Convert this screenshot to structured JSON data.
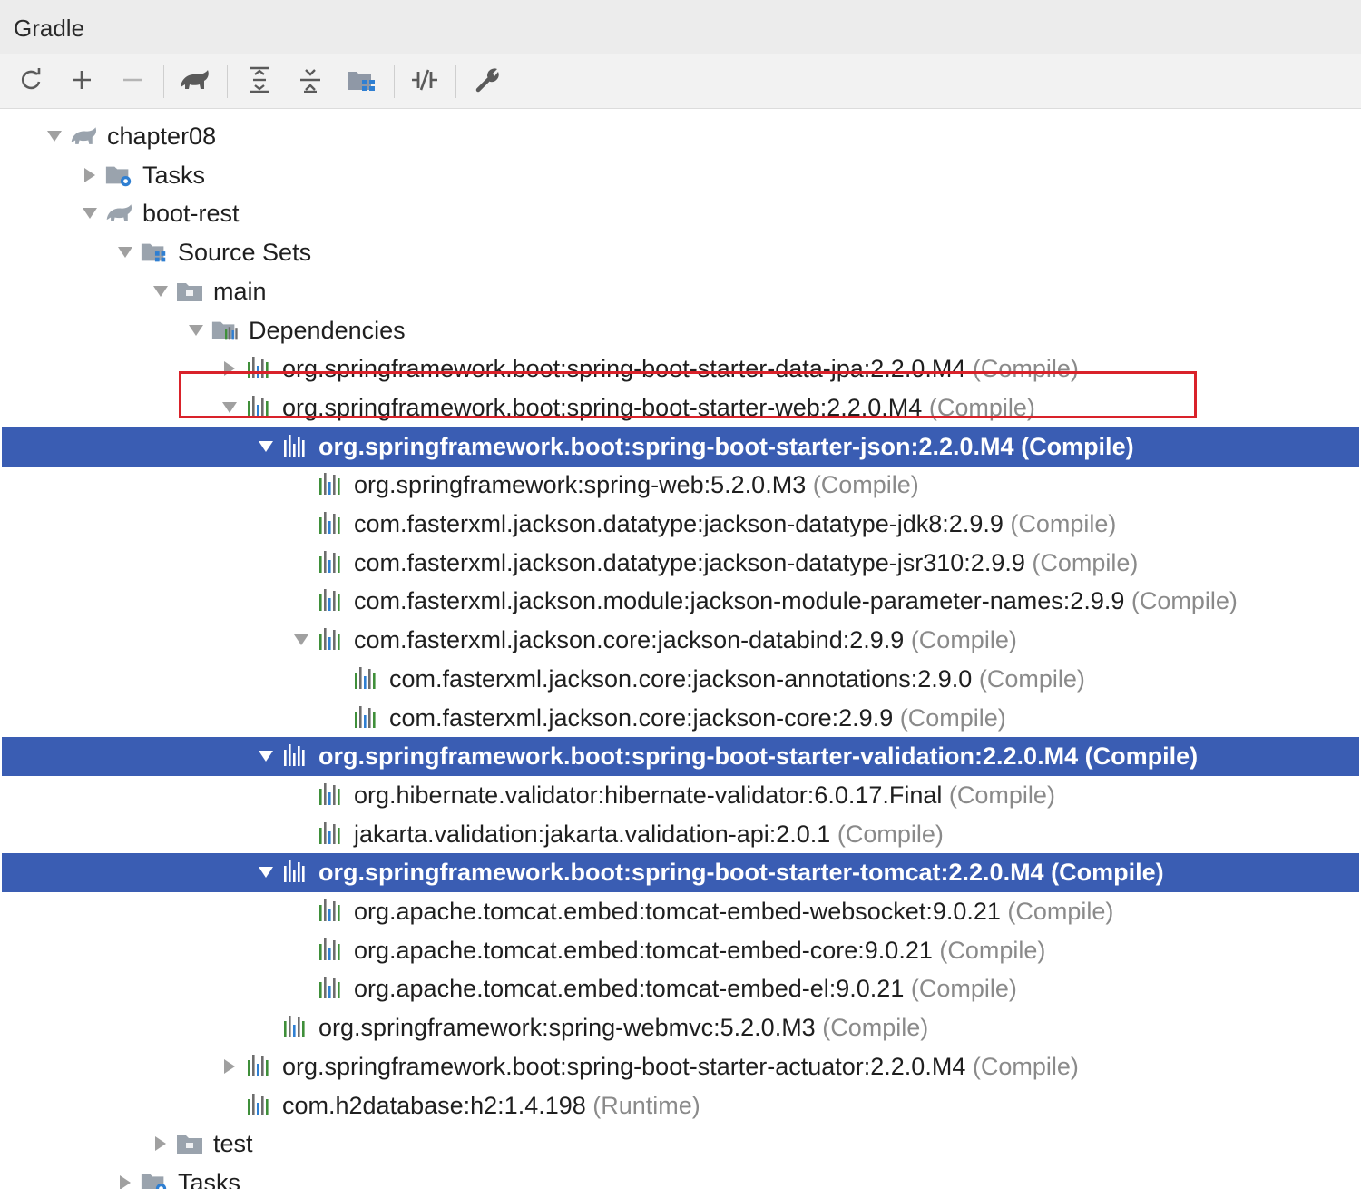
{
  "window": {
    "title": "Gradle"
  },
  "toolbar": {
    "buttons": [
      {
        "name": "refresh-icon"
      },
      {
        "name": "add-icon"
      },
      {
        "name": "remove-icon"
      },
      {
        "name": "gradle-elephant-icon"
      },
      {
        "name": "expand-all-icon"
      },
      {
        "name": "collapse-all-icon"
      },
      {
        "name": "group-modules-icon"
      },
      {
        "name": "toggle-offline-icon"
      },
      {
        "name": "wrench-icon"
      }
    ]
  },
  "tree": {
    "rows": [
      {
        "label": "chapter08",
        "scope": "",
        "icon": "gradle-project-icon",
        "arrow": "down",
        "selected": false
      },
      {
        "label": "Tasks",
        "scope": "",
        "icon": "tasks-folder-icon",
        "arrow": "right",
        "selected": false
      },
      {
        "label": "boot-rest",
        "scope": "",
        "icon": "gradle-project-icon",
        "arrow": "down",
        "selected": false
      },
      {
        "label": "Source Sets",
        "scope": "",
        "icon": "source-sets-icon",
        "arrow": "down",
        "selected": false
      },
      {
        "label": "main",
        "scope": "",
        "icon": "folder-icon",
        "arrow": "down",
        "selected": false
      },
      {
        "label": "Dependencies",
        "scope": "",
        "icon": "dependencies-folder-icon",
        "arrow": "down",
        "selected": false
      },
      {
        "label": "org.springframework.boot:spring-boot-starter-data-jpa:2.2.0.M4",
        "scope": "(Compile)",
        "icon": "library-icon",
        "arrow": "right",
        "selected": false
      },
      {
        "label": "org.springframework.boot:spring-boot-starter-web:2.2.0.M4",
        "scope": "(Compile)",
        "icon": "library-icon",
        "arrow": "down",
        "selected": false
      },
      {
        "label": "org.springframework.boot:spring-boot-starter-json:2.2.0.M4",
        "scope": "(Compile)",
        "icon": "library-icon",
        "arrow": "down",
        "selected": true
      },
      {
        "label": "org.springframework:spring-web:5.2.0.M3",
        "scope": "(Compile)",
        "icon": "library-icon",
        "arrow": "",
        "selected": false
      },
      {
        "label": "com.fasterxml.jackson.datatype:jackson-datatype-jdk8:2.9.9",
        "scope": "(Compile)",
        "icon": "library-icon",
        "arrow": "",
        "selected": false
      },
      {
        "label": "com.fasterxml.jackson.datatype:jackson-datatype-jsr310:2.9.9",
        "scope": "(Compile)",
        "icon": "library-icon",
        "arrow": "",
        "selected": false
      },
      {
        "label": "com.fasterxml.jackson.module:jackson-module-parameter-names:2.9.9",
        "scope": "(Compile)",
        "icon": "library-icon",
        "arrow": "",
        "selected": false
      },
      {
        "label": "com.fasterxml.jackson.core:jackson-databind:2.9.9",
        "scope": "(Compile)",
        "icon": "library-icon",
        "arrow": "down",
        "selected": false
      },
      {
        "label": "com.fasterxml.jackson.core:jackson-annotations:2.9.0",
        "scope": "(Compile)",
        "icon": "library-icon",
        "arrow": "",
        "selected": false
      },
      {
        "label": "com.fasterxml.jackson.core:jackson-core:2.9.9",
        "scope": "(Compile)",
        "icon": "library-icon",
        "arrow": "",
        "selected": false
      },
      {
        "label": "org.springframework.boot:spring-boot-starter-validation:2.2.0.M4",
        "scope": "(Compile)",
        "icon": "library-icon",
        "arrow": "down",
        "selected": true
      },
      {
        "label": "org.hibernate.validator:hibernate-validator:6.0.17.Final",
        "scope": "(Compile)",
        "icon": "library-icon",
        "arrow": "",
        "selected": false
      },
      {
        "label": "jakarta.validation:jakarta.validation-api:2.0.1",
        "scope": "(Compile)",
        "icon": "library-icon",
        "arrow": "",
        "selected": false
      },
      {
        "label": "org.springframework.boot:spring-boot-starter-tomcat:2.2.0.M4",
        "scope": "(Compile)",
        "icon": "library-icon",
        "arrow": "down",
        "selected": true
      },
      {
        "label": "org.apache.tomcat.embed:tomcat-embed-websocket:9.0.21",
        "scope": "(Compile)",
        "icon": "library-icon",
        "arrow": "",
        "selected": false
      },
      {
        "label": "org.apache.tomcat.embed:tomcat-embed-core:9.0.21",
        "scope": "(Compile)",
        "icon": "library-icon",
        "arrow": "",
        "selected": false
      },
      {
        "label": "org.apache.tomcat.embed:tomcat-embed-el:9.0.21",
        "scope": "(Compile)",
        "icon": "library-icon",
        "arrow": "",
        "selected": false
      },
      {
        "label": "org.springframework:spring-webmvc:5.2.0.M3",
        "scope": "(Compile)",
        "icon": "library-icon",
        "arrow": "",
        "selected": false
      },
      {
        "label": "org.springframework.boot:spring-boot-starter-actuator:2.2.0.M4",
        "scope": "(Compile)",
        "icon": "library-icon",
        "arrow": "right",
        "selected": false
      },
      {
        "label": "com.h2database:h2:1.4.198",
        "scope": "(Runtime)",
        "icon": "library-icon",
        "arrow": "",
        "selected": false
      },
      {
        "label": "test",
        "scope": "",
        "icon": "folder-icon",
        "arrow": "right",
        "selected": false
      },
      {
        "label": "Tasks",
        "scope": "",
        "icon": "tasks-folder-icon",
        "arrow": "right",
        "selected": false
      }
    ]
  },
  "colors": {
    "selection": "#3a5db3",
    "highlight_border": "#d9222a",
    "scope_text": "#8a8a8a"
  }
}
